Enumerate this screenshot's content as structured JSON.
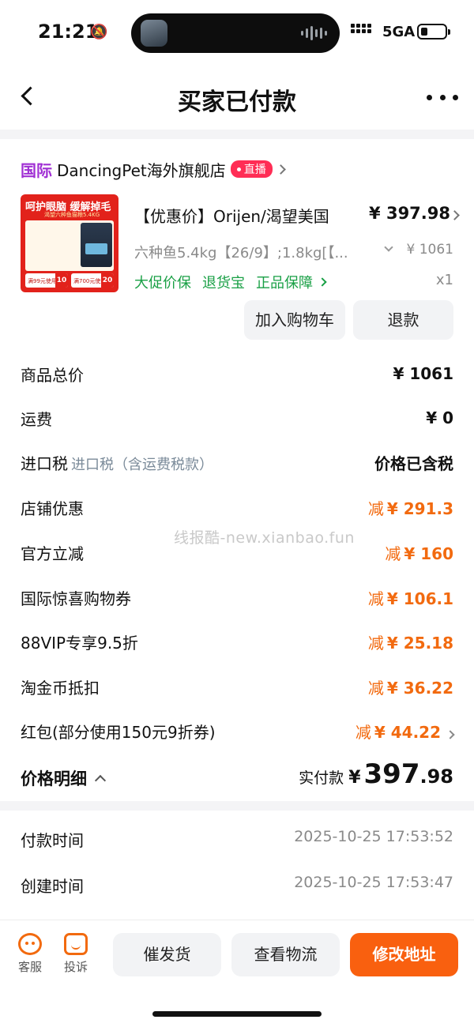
{
  "status_bar": {
    "time": "21:21",
    "network": "5GA",
    "colors": {
      "text": "#111111"
    }
  },
  "nav": {
    "title": "买家已付款"
  },
  "shop": {
    "tag": "国际",
    "name": "DancingPet海外旗舰店",
    "live_badge": "直播"
  },
  "product": {
    "thumb_headline": "呵护眼脑 缓解掉毛",
    "thumb_sub": "渴望六种鱼猫粮5.4KG",
    "thumb_coupon_1": {
      "text": "满99元使用",
      "value": "10"
    },
    "thumb_coupon_2": {
      "text": "满700元使用",
      "value": "20"
    },
    "title": "【优惠价】Orijen/渴望美国",
    "price": "¥ 397.98",
    "sku": "六种鱼5.4kg【26/9】;1.8kg[【...",
    "original_price": "¥ 1061",
    "quantity": "x1",
    "badges": [
      "大促价保",
      "退货宝",
      "正品保障"
    ]
  },
  "actions": {
    "add_cart": "加入购物车",
    "refund": "退款"
  },
  "summary": {
    "goods_total": {
      "label": "商品总价",
      "value": "¥ 1061"
    },
    "shipping": {
      "label": "运费",
      "value": "¥ 0"
    },
    "import_tax": {
      "label": "进口税",
      "sub": "进口税（含运费税款）",
      "value": "价格已含税"
    },
    "discounts": [
      {
        "label": "店铺优惠",
        "minus": "减",
        "value": "¥ 291.3"
      },
      {
        "label": "官方立减",
        "minus": "减",
        "value": "¥ 160"
      },
      {
        "label": "国际惊喜购物券",
        "minus": "减",
        "value": "¥ 106.1"
      },
      {
        "label": "88VIP专享9.5折",
        "minus": "减",
        "value": "¥ 25.18"
      },
      {
        "label": "淘金币抵扣",
        "minus": "减",
        "value": "¥ 36.22"
      },
      {
        "label": "红包(部分使用150元9折券)",
        "minus": "减",
        "value": "¥ 44.22"
      }
    ]
  },
  "watermark": "线报酷-new.xianbao.fun",
  "price_detail": {
    "label": "价格明细",
    "paid_label": "实付款",
    "currency": "¥",
    "int": "397",
    "dec": ".98"
  },
  "times": [
    {
      "label": "付款时间",
      "value": "2025-10-25 17:53:52"
    },
    {
      "label": "创建时间",
      "value": "2025-10-25 17:53:47"
    }
  ],
  "bottom_bar": {
    "service": "客服",
    "complain": "投诉",
    "urge": "催发货",
    "logistics": "查看物流",
    "change_address": "修改地址"
  },
  "colors": {
    "accent": "#f9600f",
    "discount": "#f26a0f",
    "green": "#1aa046",
    "intl": "#a02fd4",
    "live": "#ff2d55"
  },
  "icons": [
    "back-arrow-icon",
    "more-dots-icon",
    "chevron-right-icon",
    "chevron-up-icon",
    "customer-service-icon",
    "complain-icon",
    "mute-bell-icon",
    "battery-icon",
    "signal-icon"
  ]
}
